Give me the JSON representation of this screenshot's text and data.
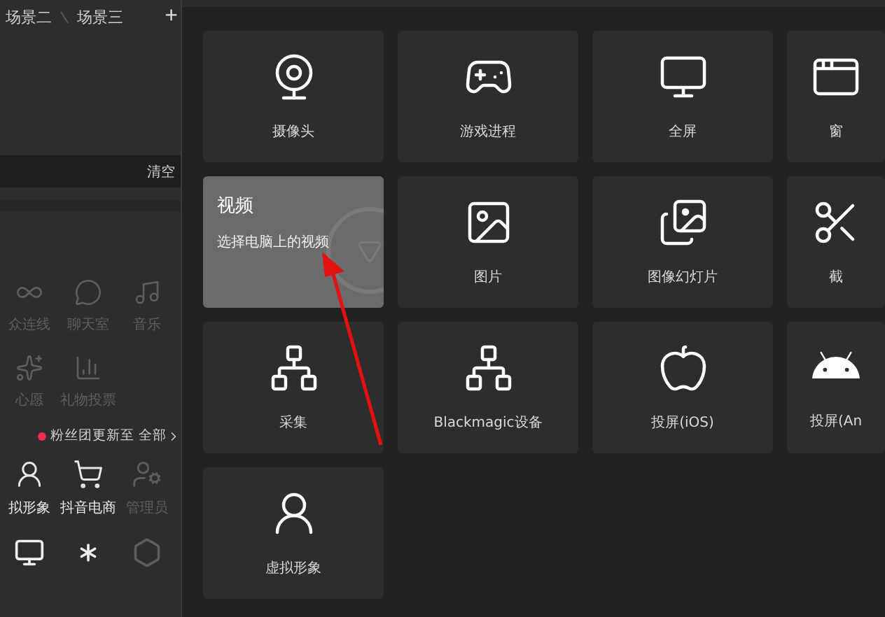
{
  "scene_tabs": [
    "场景二",
    "场景三"
  ],
  "add_tab": "+",
  "clear_button": "清空",
  "tools": [
    {
      "label": "众连线",
      "disabled": true
    },
    {
      "label": "聊天室",
      "disabled": true
    },
    {
      "label": "音乐",
      "disabled": true
    },
    {
      "label": "心愿",
      "disabled": true
    },
    {
      "label": "礼物投票",
      "disabled": true
    }
  ],
  "fan_notice": {
    "text": "粉丝团更新至",
    "link": "全部"
  },
  "widgets": [
    {
      "label": "拟形象",
      "disabled": false
    },
    {
      "label": "抖音电商",
      "disabled": false
    },
    {
      "label": "管理员",
      "disabled": true
    }
  ],
  "sources": [
    {
      "kind": "tile",
      "label": "摄像头"
    },
    {
      "kind": "tile",
      "label": "游戏进程"
    },
    {
      "kind": "tile",
      "label": "全屏"
    },
    {
      "kind": "tile",
      "label": "窗"
    },
    {
      "kind": "hover",
      "title": "视频",
      "description": "选择电脑上的视频"
    },
    {
      "kind": "tile",
      "label": "图片"
    },
    {
      "kind": "tile",
      "label": "图像幻灯片"
    },
    {
      "kind": "tile",
      "label": "截"
    },
    {
      "kind": "tile",
      "label": "采集"
    },
    {
      "kind": "tile",
      "label": "Blackmagic设备"
    },
    {
      "kind": "tile",
      "label": "投屏(iOS)"
    },
    {
      "kind": "tile",
      "label": "投屏(An"
    },
    {
      "kind": "tile",
      "label": "虚拟形象"
    }
  ]
}
